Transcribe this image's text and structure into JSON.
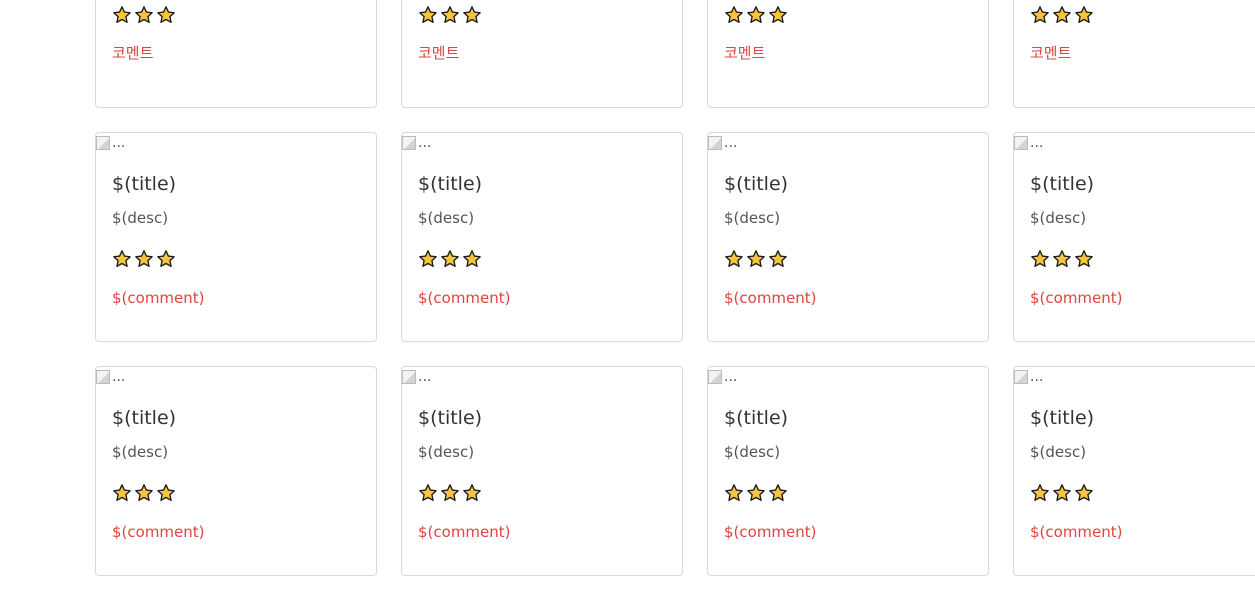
{
  "colors": {
    "comment": "#e0443c",
    "star_fill": "#f7c53b",
    "star_stroke": "#1a1a1a",
    "card_border": "#d9d9d9"
  },
  "icons": {
    "star": "star-icon",
    "broken_image": "broken-image-icon"
  },
  "rows": [
    {
      "cards": [
        {
          "stars": 3,
          "comment": "코멘트"
        },
        {
          "stars": 3,
          "comment": "코멘트"
        },
        {
          "stars": 3,
          "comment": "코멘트"
        },
        {
          "stars": 3,
          "comment": "코멘트"
        }
      ]
    },
    {
      "cards": [
        {
          "image_alt": "...",
          "title": "$(title)",
          "desc": "$(desc)",
          "stars": 3,
          "comment": "$(comment)"
        },
        {
          "image_alt": "...",
          "title": "$(title)",
          "desc": "$(desc)",
          "stars": 3,
          "comment": "$(comment)"
        },
        {
          "image_alt": "...",
          "title": "$(title)",
          "desc": "$(desc)",
          "stars": 3,
          "comment": "$(comment)"
        },
        {
          "image_alt": "...",
          "title": "$(title)",
          "desc": "$(desc)",
          "stars": 3,
          "comment": "$(comment)"
        }
      ]
    },
    {
      "cards": [
        {
          "image_alt": "...",
          "title": "$(title)",
          "desc": "$(desc)",
          "stars": 3,
          "comment": "$(comment)"
        },
        {
          "image_alt": "...",
          "title": "$(title)",
          "desc": "$(desc)",
          "stars": 3,
          "comment": "$(comment)"
        },
        {
          "image_alt": "...",
          "title": "$(title)",
          "desc": "$(desc)",
          "stars": 3,
          "comment": "$(comment)"
        },
        {
          "image_alt": "...",
          "title": "$(title)",
          "desc": "$(desc)",
          "stars": 3,
          "comment": "$(comment)"
        }
      ]
    }
  ]
}
